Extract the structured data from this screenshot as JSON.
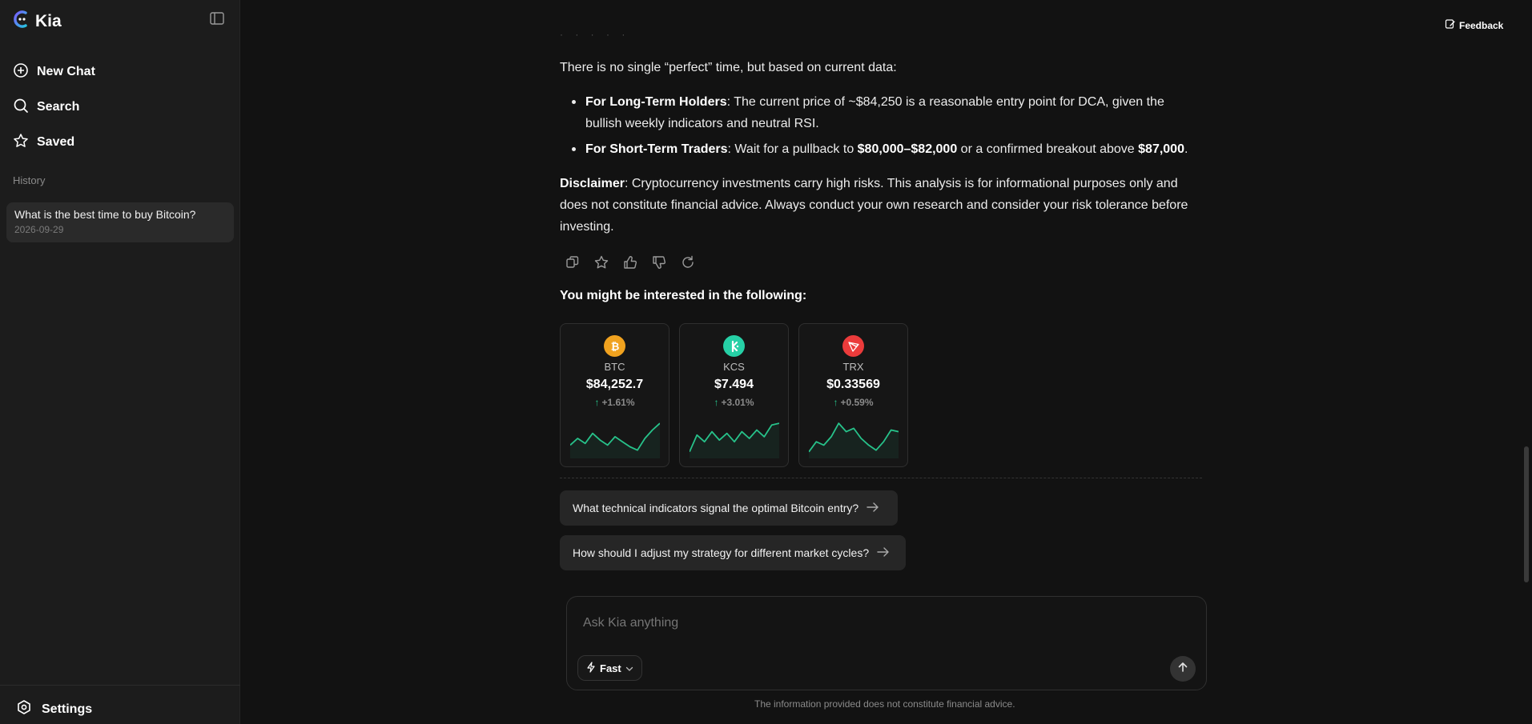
{
  "brand": {
    "name": "Kia"
  },
  "sidebar": {
    "items": [
      {
        "label": "New Chat",
        "icon": "plus-circle-icon"
      },
      {
        "label": "Search",
        "icon": "search-icon"
      },
      {
        "label": "Saved",
        "icon": "star-icon"
      }
    ],
    "history_label": "History",
    "history": [
      {
        "title": "What is the best time to buy Bitcoin?",
        "date": "2026-09-29"
      }
    ],
    "settings_label": "Settings"
  },
  "header": {
    "feedback_label": "Feedback"
  },
  "answer": {
    "faint_dots": "· · · · ·",
    "intro": "There is no single “perfect” time, but based on current data:",
    "points": [
      {
        "label": "For Long-Term Holders",
        "text": ": The current price of ~$84,250 is a reasonable entry point for DCA, given the bullish weekly indicators and neutral RSI."
      },
      {
        "label": "For Short-Term Traders",
        "text_a": ": Wait for a pullback to ",
        "range": "$80,000–$82,000",
        "text_b": " or a confirmed breakout above ",
        "target": "$87,000",
        "text_c": "."
      }
    ],
    "disclaimer_label": "Disclaimer",
    "disclaimer_text": ": Cryptocurrency investments carry high risks. This analysis is for informational purposes only and does not constitute financial advice. Always conduct your own research and consider your risk tolerance before investing."
  },
  "actions": [
    "copy-icon",
    "star-icon",
    "thumbs-up-icon",
    "thumbs-down-icon",
    "refresh-icon"
  ],
  "interest": {
    "title": "You might be interested in the following:",
    "cards": [
      {
        "symbol": "BTC",
        "price": "$84,252.7",
        "change": "+1.61%",
        "color": "#f0a21f",
        "icon": "bitcoin-icon",
        "trend": [
          0.3,
          0.5,
          0.35,
          0.65,
          0.45,
          0.3,
          0.55,
          0.4,
          0.25,
          0.15,
          0.5,
          0.75,
          0.95
        ]
      },
      {
        "symbol": "KCS",
        "price": "$7.494",
        "change": "+3.01%",
        "color": "#26d0a6",
        "icon": "kucoin-icon",
        "trend": [
          0.1,
          0.6,
          0.4,
          0.7,
          0.45,
          0.65,
          0.4,
          0.7,
          0.5,
          0.75,
          0.55,
          0.9,
          0.95
        ]
      },
      {
        "symbol": "TRX",
        "price": "$0.33569",
        "change": "+0.59%",
        "color": "#eb3b3b",
        "icon": "tron-icon",
        "trend": [
          0.1,
          0.4,
          0.3,
          0.55,
          0.95,
          0.7,
          0.8,
          0.5,
          0.3,
          0.15,
          0.4,
          0.75,
          0.7
        ]
      }
    ]
  },
  "suggestions": [
    "What technical indicators signal the optimal Bitcoin entry?",
    "How should I adjust my strategy for different market cycles?"
  ],
  "composer": {
    "placeholder": "Ask Kia anything",
    "mode_label": "Fast"
  },
  "footnote": "The information provided does not constitute financial advice.",
  "colors": {
    "positive": "#27c28a",
    "background": "#121212",
    "sidebar": "#1c1c1c"
  }
}
